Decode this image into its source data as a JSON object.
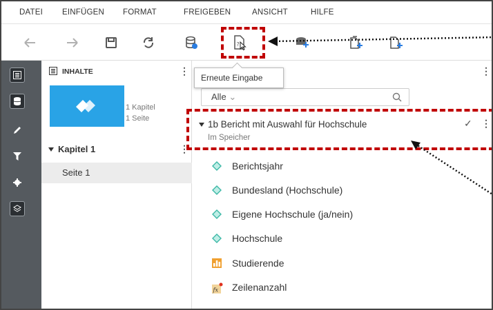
{
  "menu": {
    "items": [
      "DATEI",
      "EINFÜGEN",
      "FORMAT",
      "FREIGEBEN",
      "ANSICHT",
      "HILFE"
    ]
  },
  "toolbar": {
    "tooltip": "Erneute Eingabe"
  },
  "contents": {
    "title": "INHALTE",
    "thumb_chapters": "1 Kapitel",
    "thumb_pages": "1 Seite",
    "chapter": "Kapitel 1",
    "page": "Seite 1"
  },
  "data_panel": {
    "filter_value": "Alle",
    "datasource": {
      "name": "1b Bericht mit Auswahl für Hochschule",
      "status": "Im Speicher"
    },
    "items": [
      {
        "label": "Berichtsjahr",
        "icon": "category-diamond-icon"
      },
      {
        "label": "Bundesland (Hochschule)",
        "icon": "category-diamond-icon"
      },
      {
        "label": "Eigene Hochschule (ja/nein)",
        "icon": "category-diamond-icon"
      },
      {
        "label": "Hochschule",
        "icon": "category-diamond-icon"
      },
      {
        "label": "Studierende",
        "icon": "measure-icon"
      },
      {
        "label": "Zeilenanzahl",
        "icon": "calculated-item-icon"
      }
    ]
  },
  "colors": {
    "accent": "#29a3e6",
    "highlight": "#c00000",
    "rail": "#555a5f",
    "category": "#3cb8a6"
  }
}
